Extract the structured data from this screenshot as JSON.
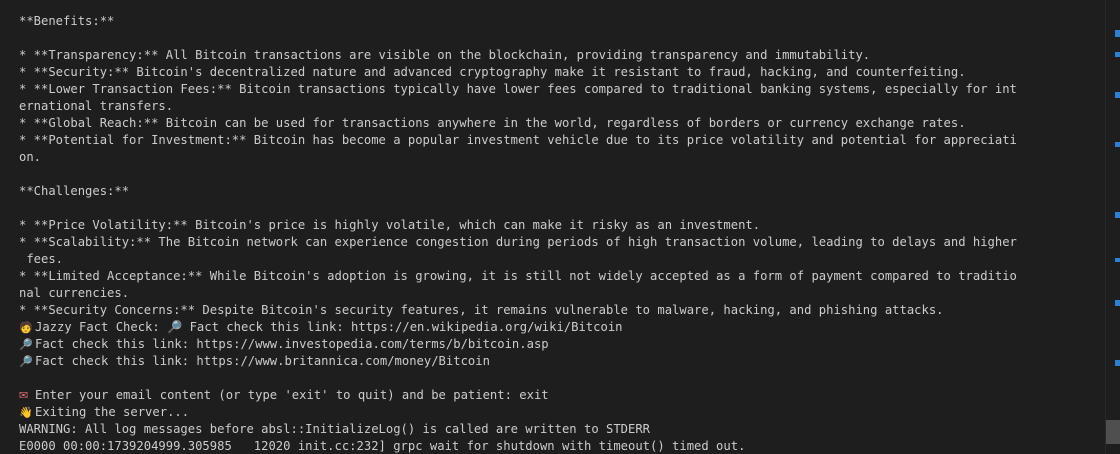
{
  "terminal": {
    "lines": [
      {
        "icon": "",
        "icon_name": "",
        "text": "**Benefits:**"
      },
      {
        "icon": "",
        "icon_name": "",
        "text": ""
      },
      {
        "icon": "",
        "icon_name": "",
        "text": "* **Transparency:** All Bitcoin transactions are visible on the blockchain, providing transparency and immutability."
      },
      {
        "icon": "",
        "icon_name": "",
        "text": "* **Security:** Bitcoin's decentralized nature and advanced cryptography make it resistant to fraud, hacking, and counterfeiting."
      },
      {
        "icon": "",
        "icon_name": "",
        "text": "* **Lower Transaction Fees:** Bitcoin transactions typically have lower fees compared to traditional banking systems, especially for int"
      },
      {
        "icon": "",
        "icon_name": "",
        "text": "ernational transfers."
      },
      {
        "icon": "",
        "icon_name": "",
        "text": "* **Global Reach:** Bitcoin can be used for transactions anywhere in the world, regardless of borders or currency exchange rates."
      },
      {
        "icon": "",
        "icon_name": "",
        "text": "* **Potential for Investment:** Bitcoin has become a popular investment vehicle due to its price volatility and potential for appreciati"
      },
      {
        "icon": "",
        "icon_name": "",
        "text": "on."
      },
      {
        "icon": "",
        "icon_name": "",
        "text": ""
      },
      {
        "icon": "",
        "icon_name": "",
        "text": "**Challenges:**"
      },
      {
        "icon": "",
        "icon_name": "",
        "text": ""
      },
      {
        "icon": "",
        "icon_name": "",
        "text": "* **Price Volatility:** Bitcoin's price is highly volatile, which can make it risky as an investment."
      },
      {
        "icon": "",
        "icon_name": "",
        "text": "* **Scalability:** The Bitcoin network can experience congestion during periods of high transaction volume, leading to delays and higher"
      },
      {
        "icon": "",
        "icon_name": "",
        "text": " fees."
      },
      {
        "icon": "",
        "icon_name": "",
        "text": "* **Limited Acceptance:** While Bitcoin's adoption is growing, it is still not widely accepted as a form of payment compared to traditio"
      },
      {
        "icon": "",
        "icon_name": "",
        "text": "nal currencies."
      },
      {
        "icon": "",
        "icon_name": "",
        "text": "* **Security Concerns:** Despite Bitcoin's security features, it remains vulnerable to malware, hacking, and phishing attacks."
      },
      {
        "icon": "🧑",
        "icon_name": "person-icon",
        "text": "Jazzy Fact Check: 🔎 Fact check this link: https://en.wikipedia.org/wiki/Bitcoin"
      },
      {
        "icon": "🔎",
        "icon_name": "magnifier-icon",
        "text": "Fact check this link: https://www.investopedia.com/terms/b/bitcoin.asp"
      },
      {
        "icon": "🔎",
        "icon_name": "magnifier-icon",
        "text": "Fact check this link: https://www.britannica.com/money/Bitcoin"
      },
      {
        "icon": "",
        "icon_name": "",
        "text": ""
      },
      {
        "icon": "✉",
        "icon_name": "envelope-icon",
        "text": "Enter your email content (or type 'exit' to quit) and be patient: exit"
      },
      {
        "icon": "👋",
        "icon_name": "waving-hand-icon",
        "text": "Exiting the server..."
      },
      {
        "icon": "",
        "icon_name": "",
        "text": "WARNING: All log messages before absl::InitializeLog() is called are written to STDERR"
      },
      {
        "icon": "",
        "icon_name": "",
        "text": "E0000 00:00:1739204999.305985   12020 init.cc:232] grpc wait for shutdown with timeout() timed out."
      }
    ]
  },
  "colors": {
    "background": "#1e1e1e",
    "foreground": "#cccccc",
    "scroll_marker": "#2f7fd1",
    "scroll_thumb": "#4f4f4f"
  }
}
